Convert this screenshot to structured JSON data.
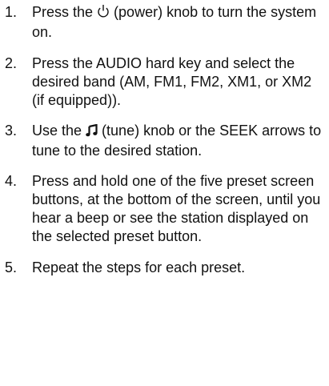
{
  "steps": [
    {
      "number": "1.",
      "before_icon": "Press the ",
      "icon": "power-icon",
      "after_icon": " (power) knob to turn the system on."
    },
    {
      "number": "2.",
      "text": "Press the AUDIO hard key and select the desired band (AM, FM1, FM2, XM1, or XM2 (if equipped))."
    },
    {
      "number": "3.",
      "before_icon": "Use the ",
      "icon": "music-note-icon",
      "after_icon": " (tune) knob or the SEEK arrows to tune to the desired station."
    },
    {
      "number": "4.",
      "text": "Press and hold one of the five preset screen buttons, at the bottom of the screen, until you hear a beep or see the station displayed on the selected preset button."
    },
    {
      "number": "5.",
      "text": "Repeat the steps for each preset."
    }
  ]
}
